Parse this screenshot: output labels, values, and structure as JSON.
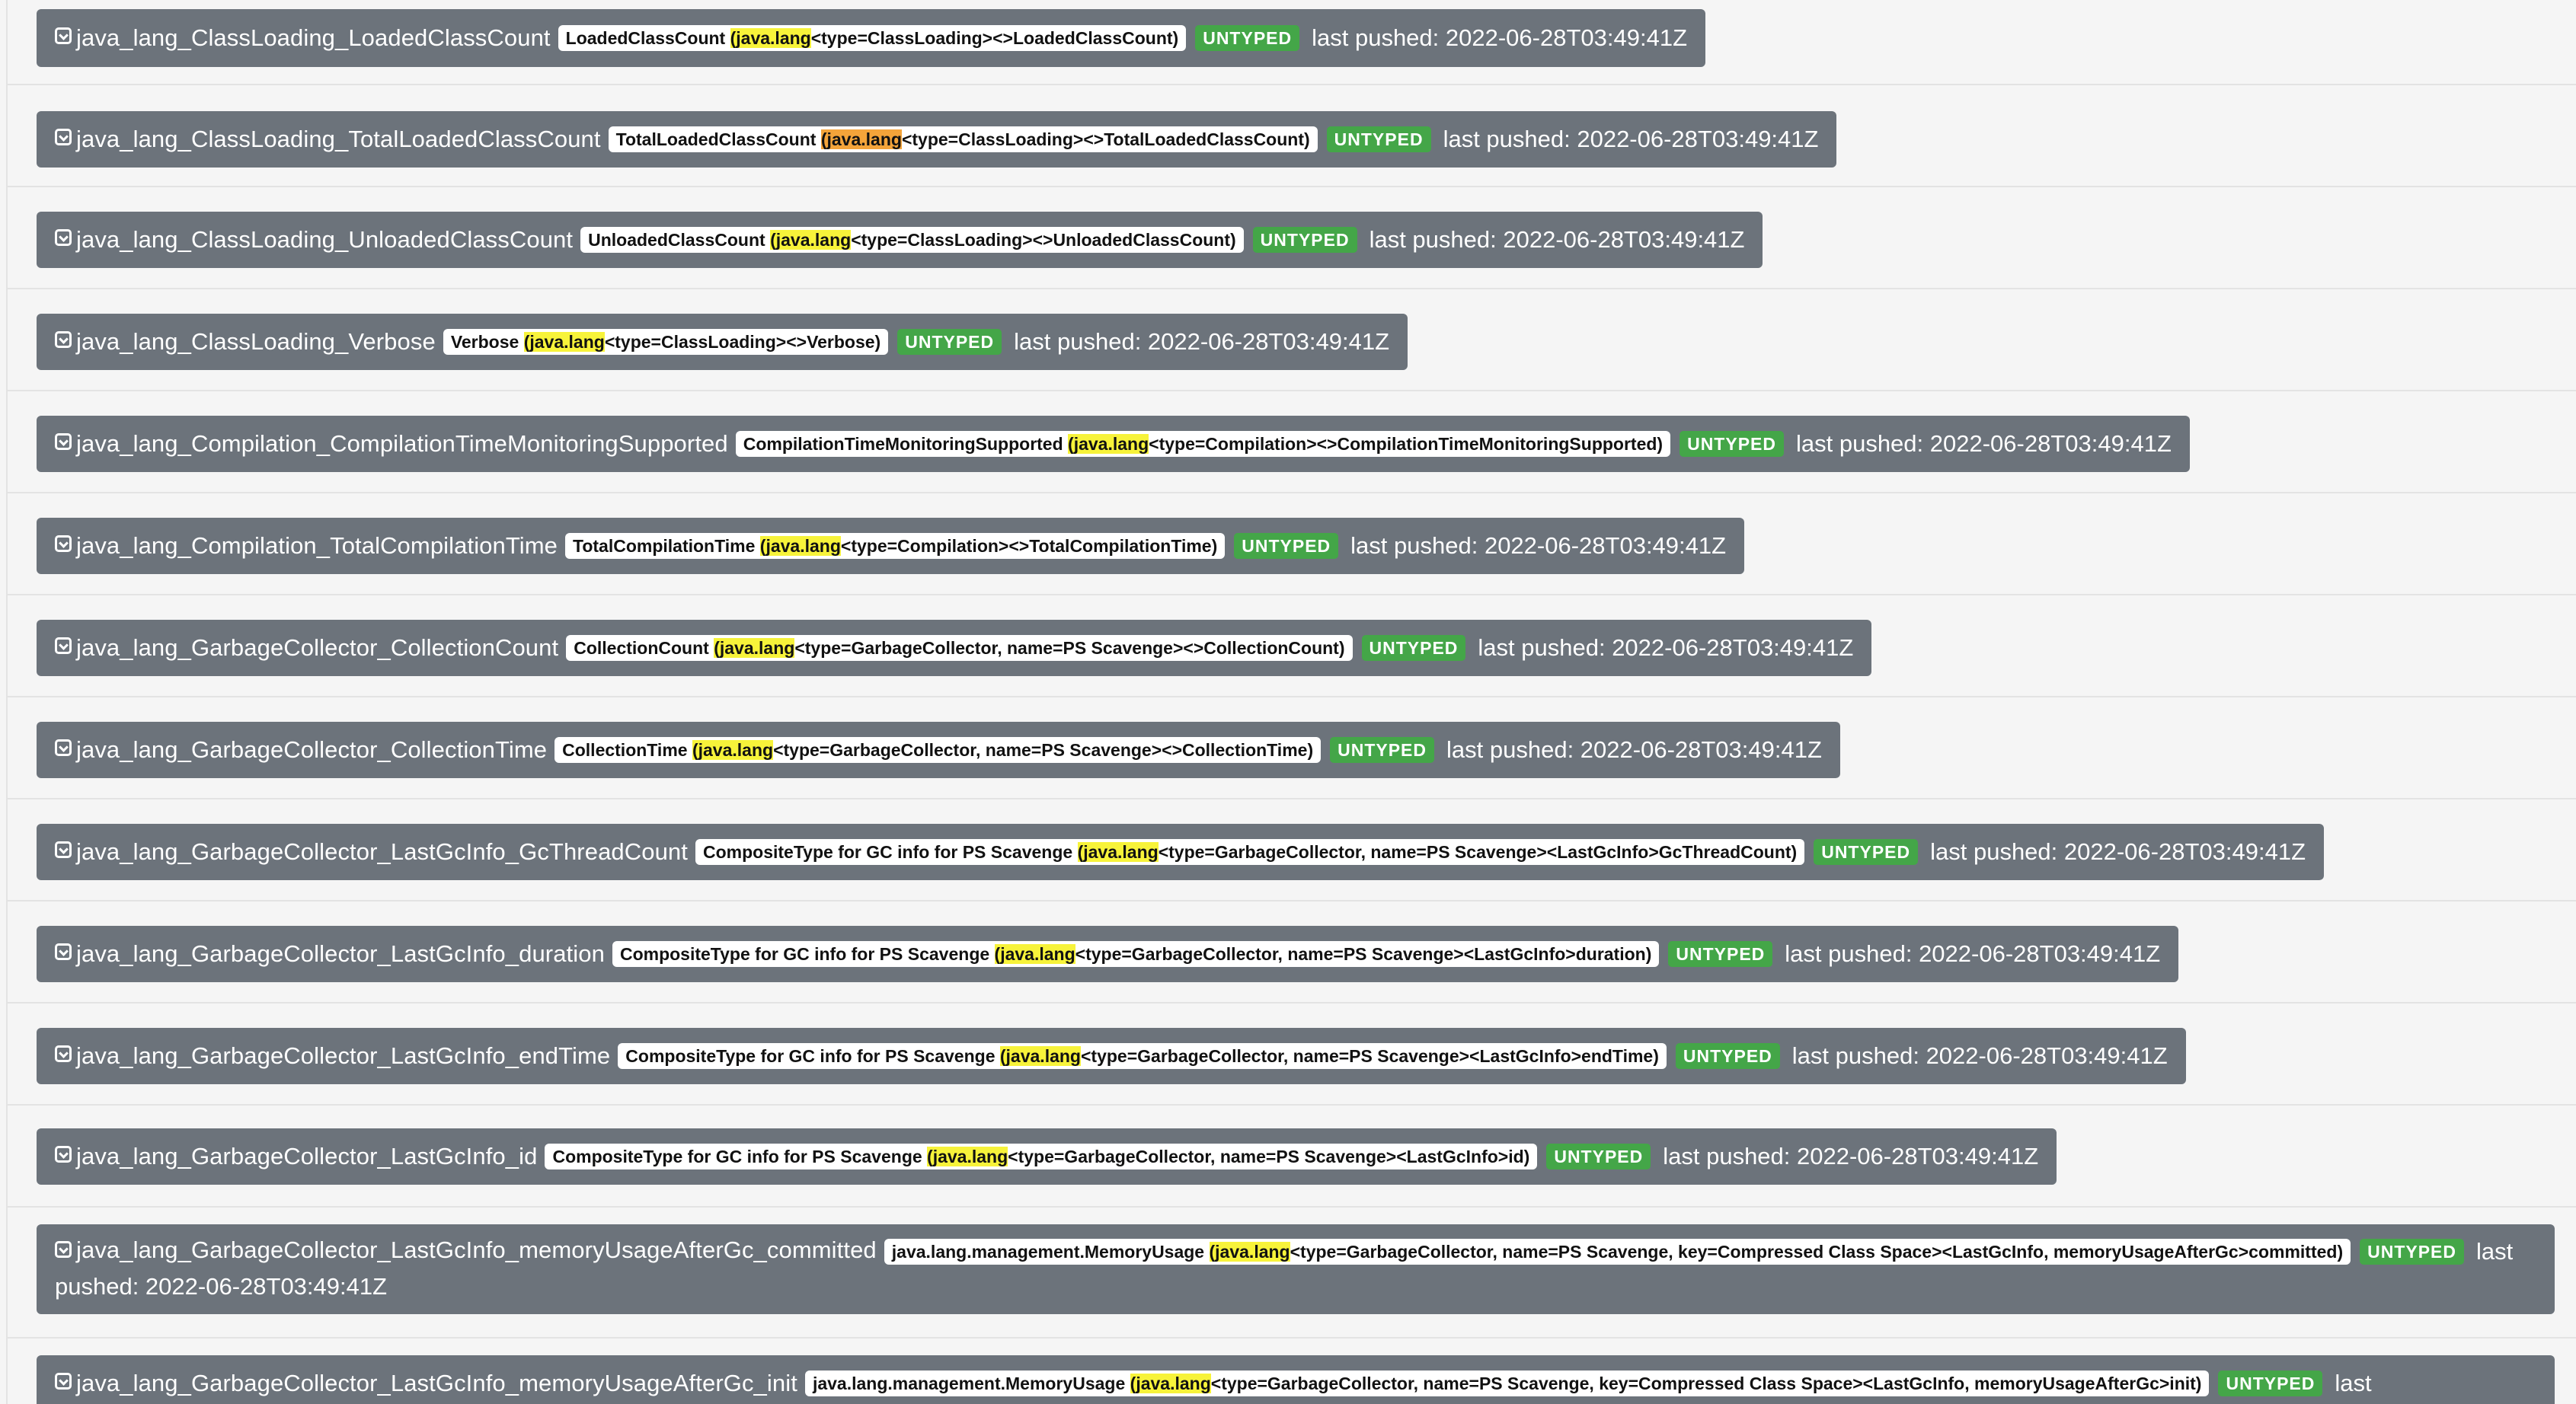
{
  "metrics": [
    {
      "name": "java_lang_ClassLoading_LoadedClassCount",
      "help_pre": "LoadedClassCount ",
      "help_hl": "(java.lang",
      "help_post": "<type=ClassLoading><>LoadedClassCount)",
      "badge": "UNTYPED",
      "pushed": "last pushed: 2022-06-28T03:49:41Z"
    },
    {
      "name": "java_lang_ClassLoading_TotalLoadedClassCount",
      "help_pre": "TotalLoadedClassCount ",
      "help_hl": "(java.lang",
      "help_post": "<type=ClassLoading><>TotalLoadedClassCount)",
      "badge": "UNTYPED",
      "pushed": "last pushed: 2022-06-28T03:49:41Z"
    },
    {
      "name": "java_lang_ClassLoading_UnloadedClassCount",
      "help_pre": "UnloadedClassCount ",
      "help_hl": "(java.lang",
      "help_post": "<type=ClassLoading><>UnloadedClassCount)",
      "badge": "UNTYPED",
      "pushed": "last pushed: 2022-06-28T03:49:41Z"
    },
    {
      "name": "java_lang_ClassLoading_Verbose",
      "help_pre": "Verbose ",
      "help_hl": "(java.lang",
      "help_post": "<type=ClassLoading><>Verbose)",
      "badge": "UNTYPED",
      "pushed": "last pushed: 2022-06-28T03:49:41Z"
    },
    {
      "name": "java_lang_Compilation_CompilationTimeMonitoringSupported",
      "help_pre": "CompilationTimeMonitoringSupported ",
      "help_hl": "(java.lang",
      "help_post": "<type=Compilation><>CompilationTimeMonitoringSupported)",
      "badge": "UNTYPED",
      "pushed": "last pushed: 2022-06-28T03:49:41Z"
    },
    {
      "name": "java_lang_Compilation_TotalCompilationTime",
      "help_pre": "TotalCompilationTime ",
      "help_hl": "(java.lang",
      "help_post": "<type=Compilation><>TotalCompilationTime)",
      "badge": "UNTYPED",
      "pushed": "last pushed: 2022-06-28T03:49:41Z"
    },
    {
      "name": "java_lang_GarbageCollector_CollectionCount",
      "help_pre": "CollectionCount ",
      "help_hl": "(java.lang",
      "help_post": "<type=GarbageCollector, name=PS Scavenge><>CollectionCount)",
      "badge": "UNTYPED",
      "pushed": "last pushed: 2022-06-28T03:49:41Z"
    },
    {
      "name": "java_lang_GarbageCollector_CollectionTime",
      "help_pre": "CollectionTime ",
      "help_hl": "(java.lang",
      "help_post": "<type=GarbageCollector, name=PS Scavenge><>CollectionTime)",
      "badge": "UNTYPED",
      "pushed": "last pushed: 2022-06-28T03:49:41Z"
    },
    {
      "name": "java_lang_GarbageCollector_LastGcInfo_GcThreadCount",
      "help_pre": "CompositeType for GC info for PS Scavenge ",
      "help_hl": "(java.lang",
      "help_post": "<type=GarbageCollector, name=PS Scavenge><LastGcInfo>GcThreadCount)",
      "badge": "UNTYPED",
      "pushed": "last pushed: 2022-06-28T03:49:41Z"
    },
    {
      "name": "java_lang_GarbageCollector_LastGcInfo_duration",
      "help_pre": "CompositeType for GC info for PS Scavenge ",
      "help_hl": "(java.lang",
      "help_post": "<type=GarbageCollector, name=PS Scavenge><LastGcInfo>duration)",
      "badge": "UNTYPED",
      "pushed": "last pushed: 2022-06-28T03:49:41Z"
    },
    {
      "name": "java_lang_GarbageCollector_LastGcInfo_endTime",
      "help_pre": "CompositeType for GC info for PS Scavenge ",
      "help_hl": "(java.lang",
      "help_post": "<type=GarbageCollector, name=PS Scavenge><LastGcInfo>endTime)",
      "badge": "UNTYPED",
      "pushed": "last pushed: 2022-06-28T03:49:41Z"
    },
    {
      "name": "java_lang_GarbageCollector_LastGcInfo_id",
      "help_pre": "CompositeType for GC info for PS Scavenge ",
      "help_hl": "(java.lang",
      "help_post": "<type=GarbageCollector, name=PS Scavenge><LastGcInfo>id)",
      "badge": "UNTYPED",
      "pushed": "last pushed: 2022-06-28T03:49:41Z"
    },
    {
      "name": "java_lang_GarbageCollector_LastGcInfo_memoryUsageAfterGc_committed",
      "help_pre": "java.lang.management.MemoryUsage ",
      "help_hl": "(java.lang",
      "help_post": "<type=GarbageCollector, name=PS Scavenge, key=Compressed Class Space><LastGcInfo, memoryUsageAfterGc>committed)",
      "badge": "UNTYPED",
      "pushed": "last pushed: 2022-06-28T03:49:41Z"
    },
    {
      "name": "java_lang_GarbageCollector_LastGcInfo_memoryUsageAfterGc_init",
      "help_pre": "java.lang.management.MemoryUsage ",
      "help_hl": "(java.lang",
      "help_post": "<type=GarbageCollector, name=PS Scavenge, key=Compressed Class Space><LastGcInfo, memoryUsageAfterGc>init)",
      "badge": "UNTYPED",
      "pushed": "last"
    }
  ],
  "colors": {
    "pill_bg": "#6c737b",
    "badge_green": "#44a648",
    "highlight_yellow": "#f7f33a",
    "highlight_orange": "#f4a43a"
  }
}
